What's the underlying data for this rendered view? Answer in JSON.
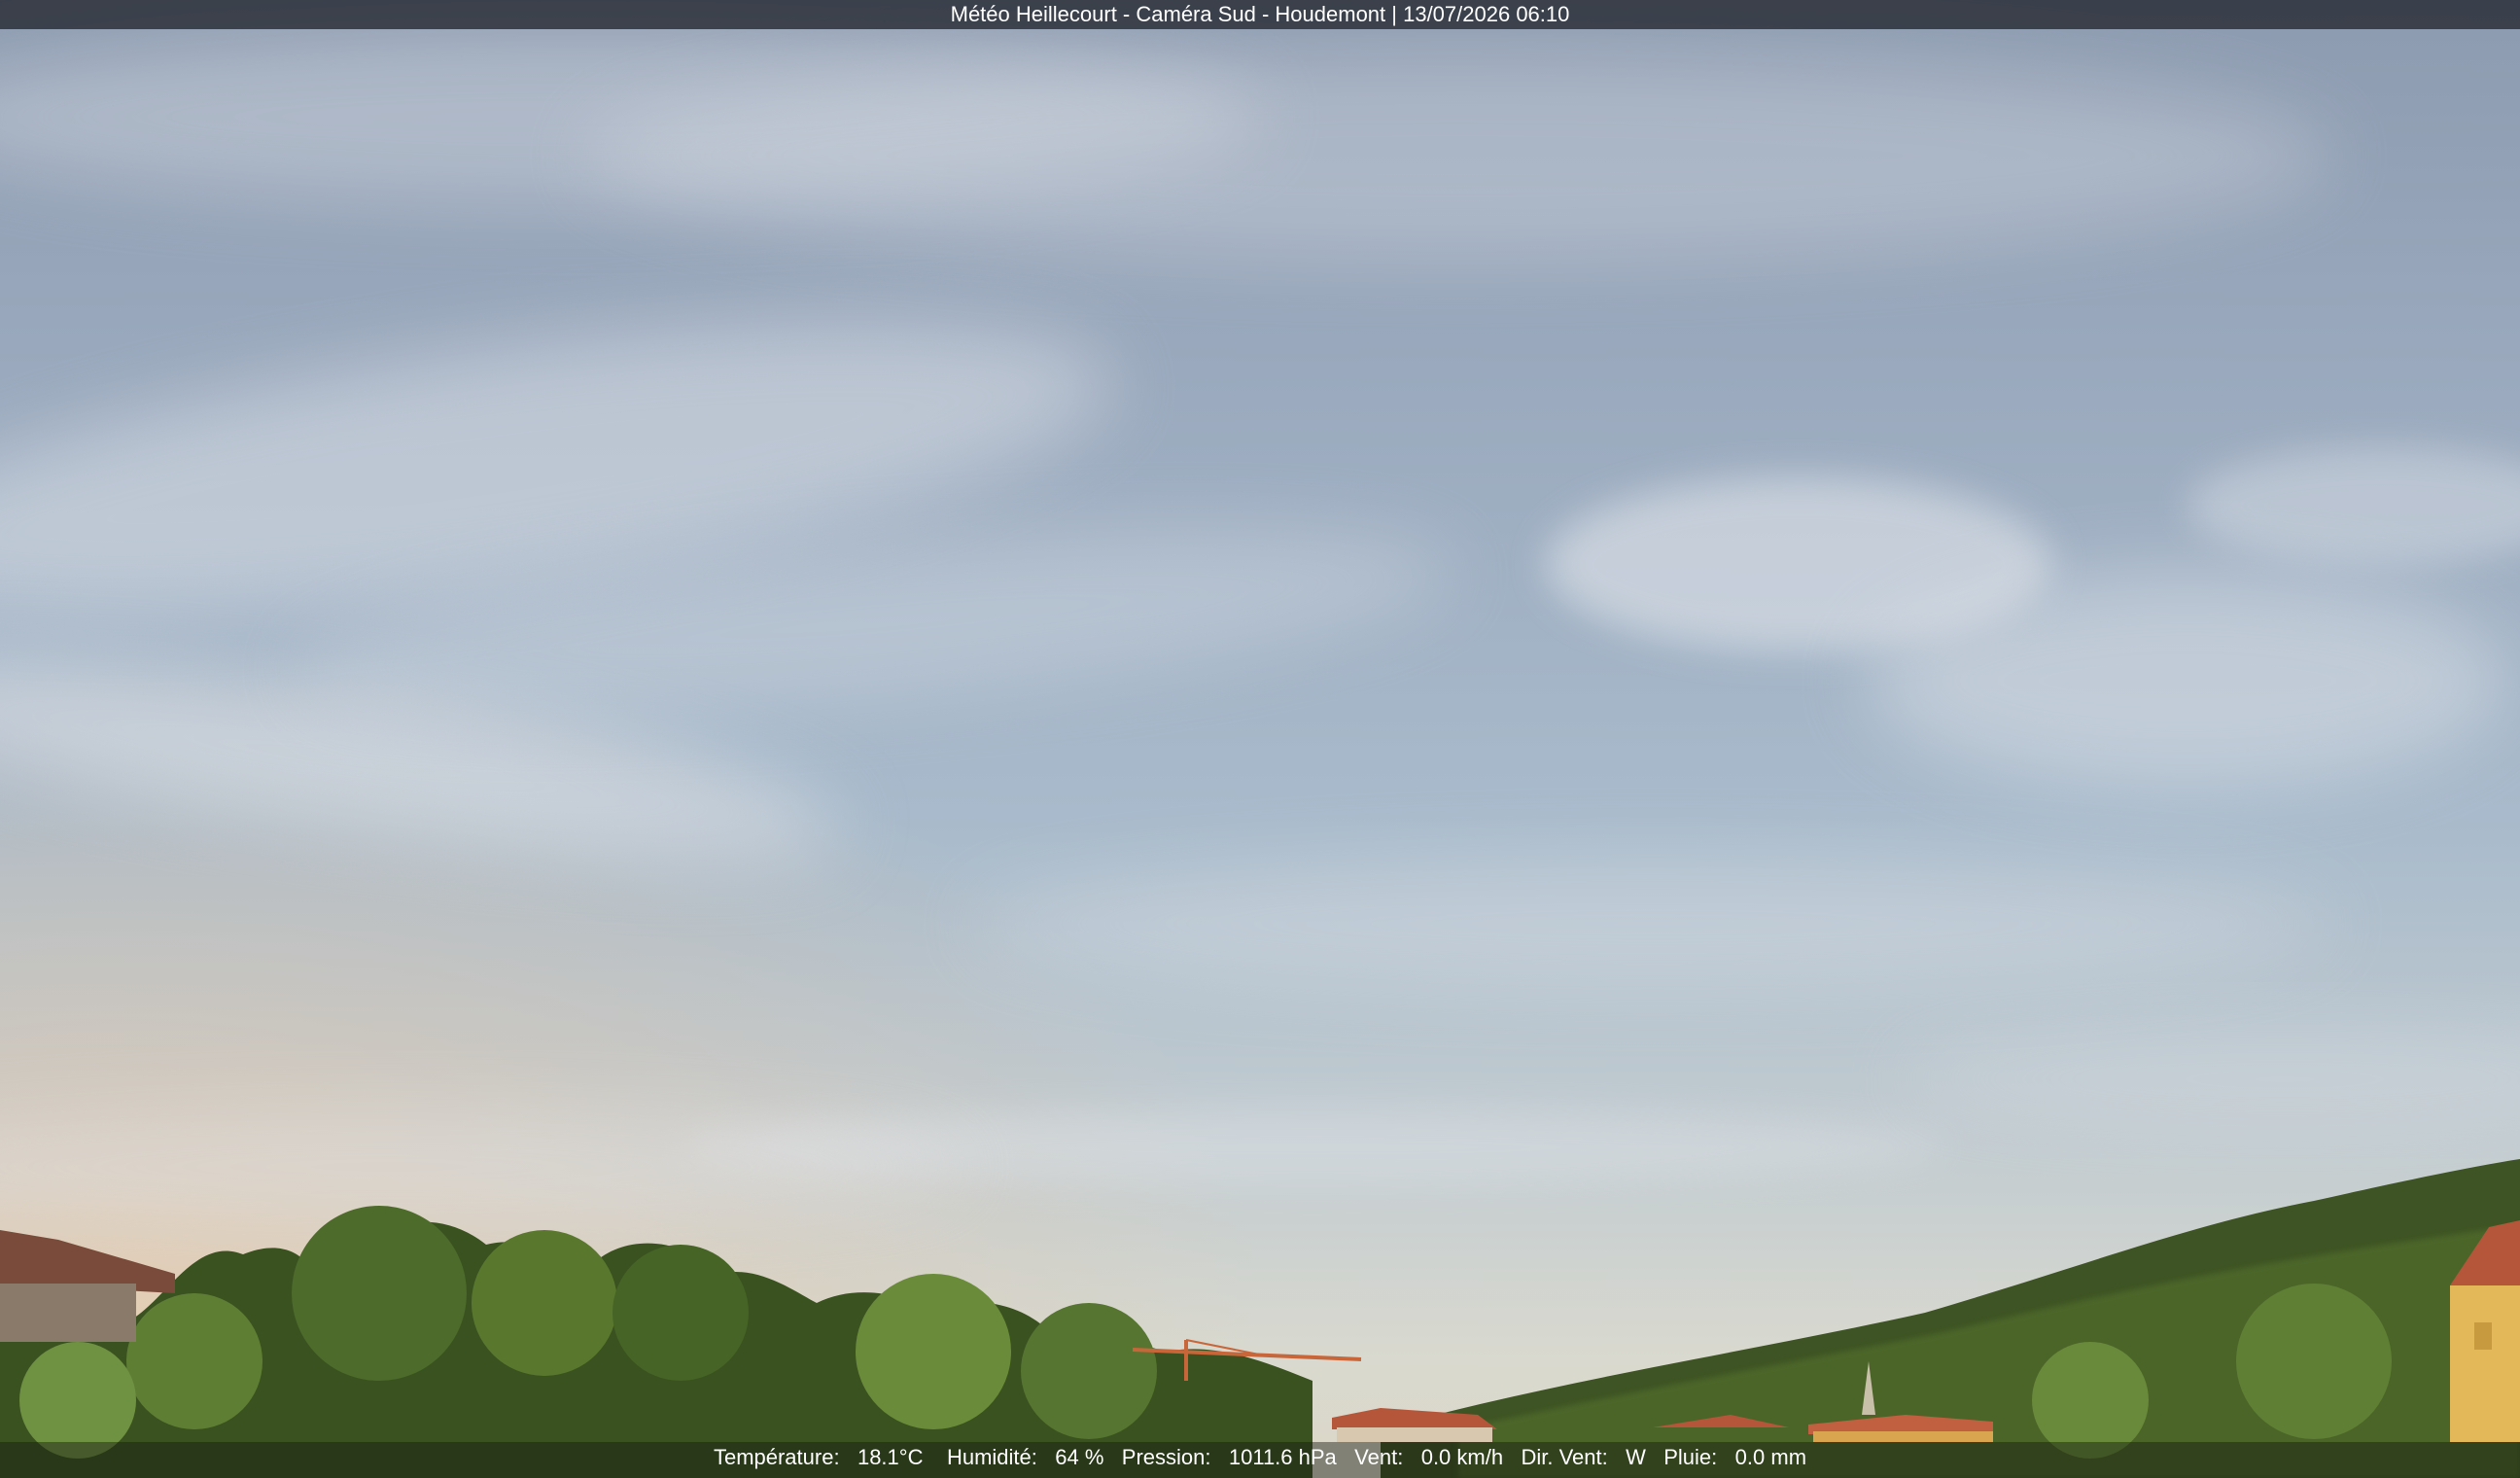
{
  "overlay": {
    "title": "Météo Heillecourt - Caméra Sud - Houdemont | 13/07/2026 06:10",
    "measurements": [
      {
        "label": "Température:",
        "value": "18.1°C"
      },
      {
        "label": "Humidité:",
        "value": "64 %"
      },
      {
        "label": "Pression:",
        "value": "1011.6 hPa"
      },
      {
        "label": "Vent:",
        "value": "0.0 km/h"
      },
      {
        "label": "Dir. Vent:",
        "value": "W"
      },
      {
        "label": "Pluie:",
        "value": "0.0 mm"
      }
    ]
  },
  "colors": {
    "sky_top": "#8f9db2",
    "sky_mid": "#a9bccd",
    "sky_horizon": "#d8d8cf",
    "haze_warm": "#e6c9a4",
    "tree_dark": "#2a3a1a",
    "tree_mid": "#4a6a2a",
    "tree_light": "#7a9a4a",
    "roof_red": "#b5563a",
    "wall_yellow": "#e3b858"
  }
}
